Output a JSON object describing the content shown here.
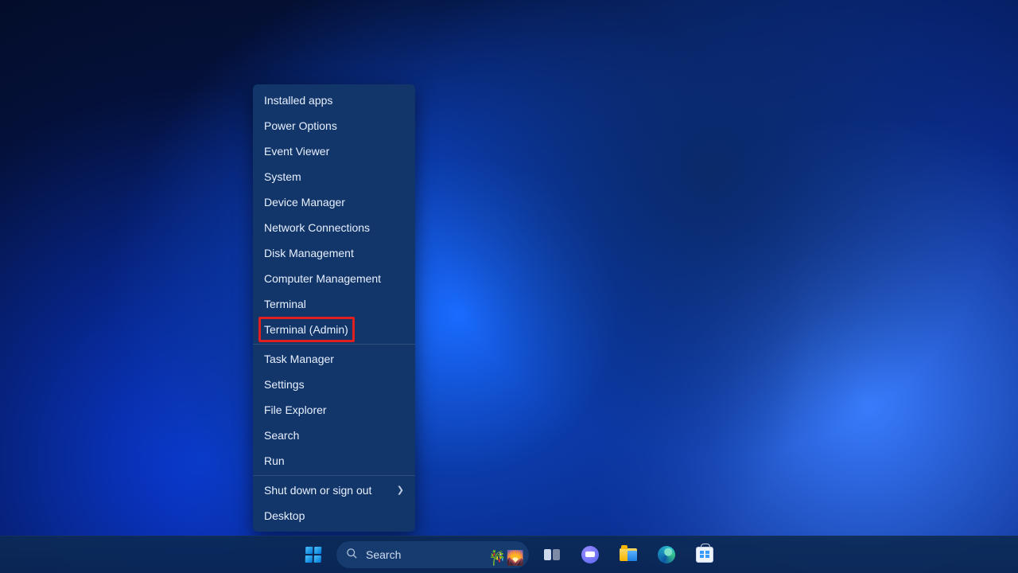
{
  "context_menu": {
    "groups": [
      [
        {
          "id": "installed-apps",
          "label": "Installed apps",
          "submenu": false
        },
        {
          "id": "power-options",
          "label": "Power Options",
          "submenu": false
        },
        {
          "id": "event-viewer",
          "label": "Event Viewer",
          "submenu": false
        },
        {
          "id": "system",
          "label": "System",
          "submenu": false
        },
        {
          "id": "device-manager",
          "label": "Device Manager",
          "submenu": false
        },
        {
          "id": "network-connections",
          "label": "Network Connections",
          "submenu": false
        },
        {
          "id": "disk-management",
          "label": "Disk Management",
          "submenu": false
        },
        {
          "id": "computer-management",
          "label": "Computer Management",
          "submenu": false
        },
        {
          "id": "terminal",
          "label": "Terminal",
          "submenu": false
        },
        {
          "id": "terminal-admin",
          "label": "Terminal (Admin)",
          "submenu": false
        }
      ],
      [
        {
          "id": "task-manager",
          "label": "Task Manager",
          "submenu": false
        },
        {
          "id": "settings",
          "label": "Settings",
          "submenu": false
        },
        {
          "id": "file-explorer",
          "label": "File Explorer",
          "submenu": false
        },
        {
          "id": "search",
          "label": "Search",
          "submenu": false
        },
        {
          "id": "run",
          "label": "Run",
          "submenu": false
        }
      ],
      [
        {
          "id": "shut-down-or-sign-out",
          "label": "Shut down or sign out",
          "submenu": true
        },
        {
          "id": "desktop",
          "label": "Desktop",
          "submenu": false
        }
      ]
    ],
    "highlighted_id": "terminal-admin"
  },
  "taskbar": {
    "search_placeholder": "Search",
    "items": [
      {
        "id": "start",
        "name": "start-button"
      },
      {
        "id": "search",
        "name": "search-box"
      },
      {
        "id": "taskview",
        "name": "task-view-button"
      },
      {
        "id": "chat",
        "name": "chat-button"
      },
      {
        "id": "explorer",
        "name": "file-explorer-button"
      },
      {
        "id": "edge",
        "name": "edge-button"
      },
      {
        "id": "store",
        "name": "microsoft-store-button"
      }
    ]
  }
}
